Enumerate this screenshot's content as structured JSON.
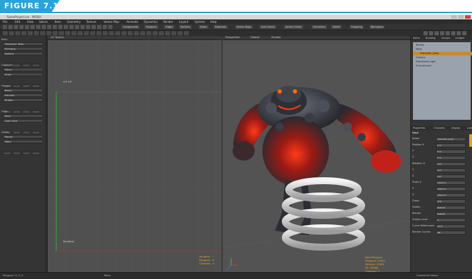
{
  "figure_label": "FIGURE 7.1",
  "window": {
    "title": "SomeProject.lxo - MODO"
  },
  "menu": [
    "File",
    "Edit",
    "View",
    "Select",
    "Item",
    "Geometry",
    "Texture",
    "Vertex Map",
    "Animate",
    "Dynamics",
    "Render",
    "Layout",
    "System",
    "Help"
  ],
  "toolbar": {
    "labels": [
      "Components",
      "Polygons",
      "Edges",
      "Vertices",
      "Items",
      "Materials",
      "Vertex Maps",
      "Auto Select",
      "Action Center",
      "Symmetry",
      "Falloff",
      "Snapping",
      "Workplane"
    ]
  },
  "left_panel": {
    "sections": [
      {
        "title": "Basic",
        "items": [
          "Transform Tools",
          "Primitive",
          "Deform"
        ]
      },
      {
        "title": "Duplicate",
        "items": [
          "Mirror",
          "Array"
        ]
      },
      {
        "title": "Polygon",
        "items": [
          "Bevel",
          "Extrude",
          "Bridge"
        ]
      },
      {
        "title": "Edge",
        "items": [
          "Slice",
          "Loop Slice"
        ]
      },
      {
        "title": "Vertex",
        "items": [
          "Merge",
          "Weld"
        ]
      }
    ]
  },
  "viewport_left": {
    "header": [
      "UV Texture"
    ],
    "coord": "u:0 v:0"
  },
  "viewport_right": {
    "header": [
      "Perspective",
      "Default",
      "Shaded"
    ],
    "stats": [
      "Item Polygons",
      "Polygons: 12543",
      "Vertices: 12401",
      "GL: 25086",
      "Channels: 2"
    ],
    "left_stats": [
      "No Items",
      "Polygons : 0",
      "Channels : 0"
    ]
  },
  "right_panel": {
    "top_tabs": [
      "Items",
      "Shading",
      "Groups",
      "Images"
    ],
    "outliner": [
      "Render",
      "Mesh",
      "character_body",
      "Camera",
      "Directional Light",
      "Environment"
    ],
    "props_tabs": [
      "Properties",
      "Channels",
      "Display",
      "Lists"
    ],
    "props_title": "Mesh",
    "props_rows": [
      {
        "label": "Name",
        "value": "character_body"
      },
      {
        "label": "Position X",
        "value": "0 m"
      },
      {
        "label": "Y",
        "value": "0 m"
      },
      {
        "label": "Z",
        "value": "0 m"
      },
      {
        "label": "Rotation X",
        "value": "0.0°"
      },
      {
        "label": "Y",
        "value": "0.0°"
      },
      {
        "label": "Z",
        "value": "0.0°"
      },
      {
        "label": "Scale X",
        "value": "100.0 %"
      },
      {
        "label": "Y",
        "value": "100.0 %"
      },
      {
        "label": "Z",
        "value": "100.0 %"
      },
      {
        "label": "Order",
        "value": "XYZ"
      },
      {
        "label": "Visible",
        "value": "Default"
      },
      {
        "label": "Render",
        "value": "Default"
      },
      {
        "label": "Subdiv Level",
        "value": "2"
      },
      {
        "label": "Curve Refinement",
        "value": "10.0°"
      },
      {
        "label": "Render Curves",
        "value": "Off"
      }
    ]
  },
  "status_bar": {
    "left": "Polygons: 0, 0, 0",
    "mid": "Move",
    "right": "Command History"
  }
}
